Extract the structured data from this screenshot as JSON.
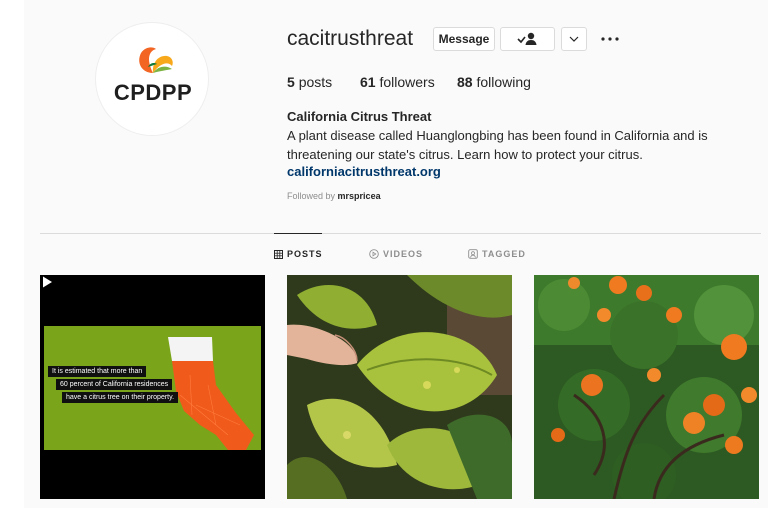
{
  "profile": {
    "username": "cacitrusthreat",
    "avatar_text": "CPDPP",
    "message_label": "Message",
    "full_name": "California Citrus Threat",
    "bio": "A plant disease called Huanglongbing has been found in California and is threatening our state's citrus. Learn how to protect your citrus.",
    "link": "californiacitrusthreat.org",
    "followed_by_prefix": "Followed by",
    "followed_by_user": "mrspricea"
  },
  "stats": {
    "posts_count": "5",
    "posts_label": "posts",
    "followers_count": "61",
    "followers_label": "followers",
    "following_count": "88",
    "following_label": "following"
  },
  "tabs": [
    {
      "label": "POSTS",
      "icon": "grid-icon",
      "active": true
    },
    {
      "label": "VIDEOS",
      "icon": "play-circle-icon",
      "active": false
    },
    {
      "label": "TAGGED",
      "icon": "tag-icon",
      "active": false
    }
  ],
  "posts": [
    {
      "type": "video",
      "caption_lines": [
        "It is estimated that more than",
        "60 percent of California residences",
        "have a citrus tree on their property."
      ]
    },
    {
      "type": "image",
      "subject": "yellowing-citrus-leaves"
    },
    {
      "type": "image",
      "subject": "orange-tree"
    }
  ],
  "colors": {
    "link": "#00376b",
    "muted": "#8e8e8e",
    "border": "#dbdbdb",
    "map_green": "#7aa51a",
    "map_orange": "#f05a1a"
  }
}
